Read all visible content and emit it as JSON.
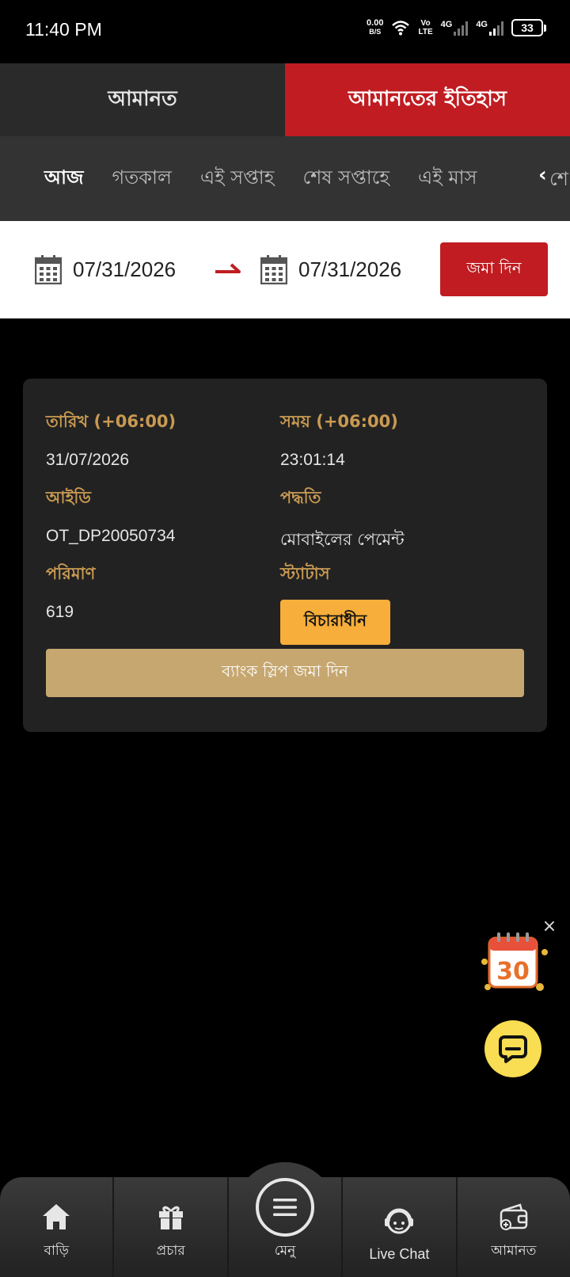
{
  "status_bar": {
    "time": "11:40 PM",
    "speed_value": "0.00",
    "speed_unit": "B/S",
    "volte_top": "Vo",
    "volte_bottom": "LTE",
    "net1": "4G",
    "net2": "4G",
    "battery": "33"
  },
  "tabs": [
    {
      "label": "আমানত",
      "active": false
    },
    {
      "label": "আমানতের ইতিহাস",
      "active": true
    }
  ],
  "period_filter": {
    "items": [
      "আজ",
      "গতকাল",
      "এই সপ্তাহ",
      "শেষ সপ্তাহে",
      "এই মাস"
    ],
    "active_index": 0,
    "overflow_text": "শে"
  },
  "date_range": {
    "start": "07/31/2026",
    "end": "07/31/2026",
    "submit_label": "জমা দিন"
  },
  "record": {
    "date_label": "তারিখ (+06:00)",
    "date_value": "31/07/2026",
    "time_label": "সময় (+06:00)",
    "time_value": "23:01:14",
    "id_label": "আইডি",
    "id_value": "OT_DP20050734",
    "method_label": "পদ্ধতি",
    "method_value": "মোবাইলের পেমেন্ট",
    "amount_label": "পরিমাণ",
    "amount_value": "619",
    "status_label": "স্ট্যাটাস",
    "status_value": "বিচারাধীন",
    "slip_button_label": "ব্যাংক স্লিপ জমা দিন"
  },
  "promo_widget": {
    "number": "30"
  },
  "bottom_nav": {
    "items": [
      {
        "label": "বাড়ি",
        "icon": "home-icon"
      },
      {
        "label": "প্রচার",
        "icon": "gift-icon"
      },
      {
        "label": "মেনু",
        "icon": "menu-icon"
      },
      {
        "label": "Live Chat",
        "icon": "live-chat-icon"
      },
      {
        "label": "আমানত",
        "icon": "wallet-icon"
      }
    ]
  },
  "colors": {
    "accent_red": "#c01c21",
    "gold_label": "#c99a52",
    "status_pending": "#f7ae3a",
    "slip_button": "#c6a770",
    "chat_fab": "#f9dd52"
  }
}
